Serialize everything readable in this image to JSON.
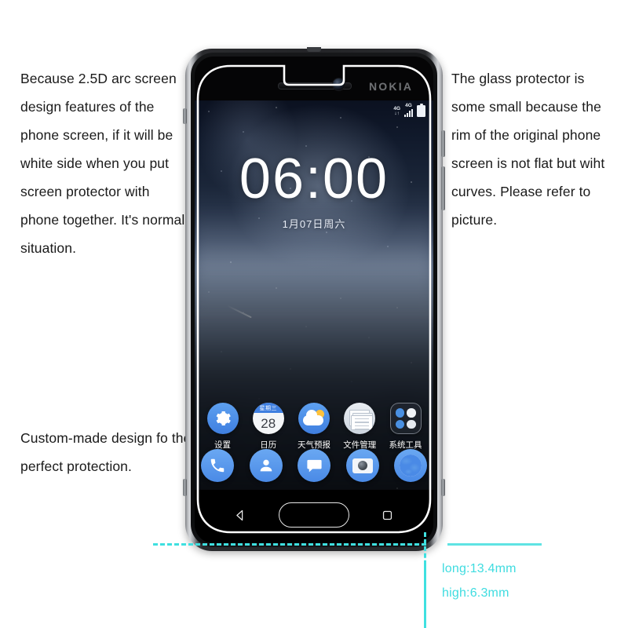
{
  "marketing": {
    "left_text": "Because 2.5D arc screen design features of the phone screen, if it will be white side when you put screen protector with phone together. It's normal situation.",
    "right_text": "The glass protector is some small because the rim of the original phone screen is not flat but wiht curves. Please refer to picture.",
    "bottom_text": "Custom-made design fo the perfect protection."
  },
  "measurements": {
    "long_label": "long:13.4mm",
    "high_label": "high:6.3mm",
    "guide_color": "#3fdce0"
  },
  "phone": {
    "brand": "NOKIA",
    "frame_color": "#232427",
    "statusbar": {
      "network_primary": "4G",
      "network_secondary": "4G",
      "sim_arrows": "↓↑",
      "signal_bars": 4,
      "battery_level_icon": "battery-full"
    },
    "lockscreen": {
      "time": "06:00",
      "date": "1月07日周六"
    },
    "apps": [
      {
        "label": "设置",
        "icon": "gear-icon"
      },
      {
        "label": "日历",
        "icon": "calendar-icon",
        "weekday": "星期三",
        "day": "28"
      },
      {
        "label": "天气预报",
        "icon": "weather-icon"
      },
      {
        "label": "文件管理",
        "icon": "files-icon"
      },
      {
        "label": "系统工具",
        "icon": "folder-icon"
      }
    ],
    "dock": [
      {
        "name": "phone",
        "icon": "phone-icon"
      },
      {
        "name": "contacts",
        "icon": "contacts-icon"
      },
      {
        "name": "messages",
        "icon": "message-icon"
      },
      {
        "name": "camera",
        "icon": "camera-icon"
      },
      {
        "name": "browser",
        "icon": "globe-icon"
      }
    ],
    "navbar": [
      {
        "name": "back",
        "icon": "back-triangle-icon"
      },
      {
        "name": "home",
        "icon": "home-fingerprint-key"
      },
      {
        "name": "recents",
        "icon": "recents-square-icon"
      }
    ]
  }
}
